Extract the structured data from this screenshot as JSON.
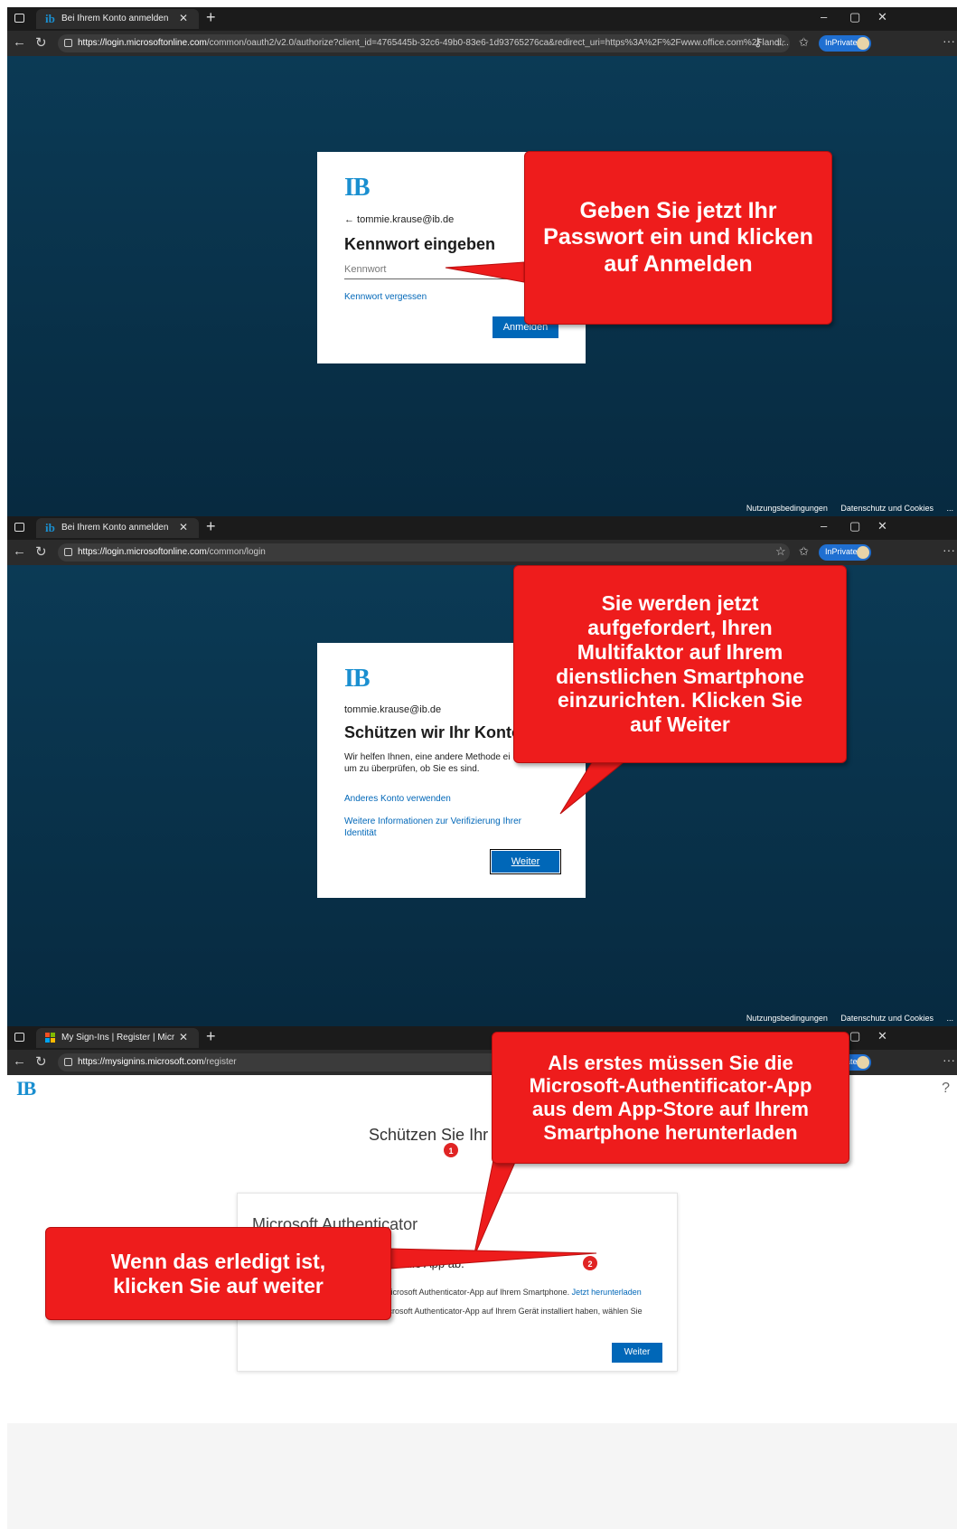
{
  "colors": {
    "callout": "#ee1c1c",
    "ms_blue": "#0067b8",
    "ib_blue": "#1a8fd0",
    "bg_dark": "#0b3a55"
  },
  "panel1": {
    "tab_title": "Bei Ihrem Konto anmelden",
    "url_domain": "https://login.microsoftonline.com",
    "url_path": "/common/oauth2/v2.0/authorize?client_id=4765445b-32c6-49b0-83e6-1d93765276ca&redirect_uri=https%3A%2F%2Fwww.office.com%2Flandi...",
    "inprivate": "InPrivate",
    "logo": "IB",
    "email": "← tommie.krause@ib.de",
    "heading": "Kennwort eingeben",
    "password_placeholder": "Kennwort",
    "forgot_link": "Kennwort vergessen",
    "signin_button": "Anmelden",
    "callout": "Geben Sie jetzt Ihr\nPasswort ein und klicken\nauf Anmelden",
    "footer_terms": "Nutzungsbedingungen",
    "footer_privacy": "Datenschutz und Cookies",
    "footer_more": "..."
  },
  "panel2": {
    "tab_title": "Bei Ihrem Konto anmelden",
    "url_domain": "https://login.microsoftonline.com",
    "url_path": "/common/login",
    "inprivate": "InPrivate",
    "logo": "IB",
    "email": "tommie.krause@ib.de",
    "heading": "Schützen wir Ihr Konto",
    "description": "Wir helfen Ihnen, eine andere Methode ei\num zu überprüfen, ob Sie es sind.",
    "link_other_account": "Anderes Konto verwenden",
    "link_more_info": "Weitere Informationen zur Verifizierung Ihrer\nIdentität",
    "next_button": "Weiter",
    "callout": "Sie werden jetzt\naufgefordert, Ihren\nMultifaktor auf Ihrem\ndienstlichen Smartphone\neinzurichten. Klicken Sie\nauf Weiter",
    "footer_terms": "Nutzungsbedingungen",
    "footer_privacy": "Datenschutz und Cookies",
    "footer_more": "..."
  },
  "panel3": {
    "tab_title": "My Sign-Ins | Register | Microsoft",
    "url_domain": "https://mysignins.microsoft.com",
    "url_path": "/register",
    "inprivate": "InPrivate",
    "logo": "IB",
    "help": "?",
    "page_title": "Schützen Sie Ihr",
    "card_title": "Microsoft Authenticator",
    "card_subtitle": "Rufen Sie zuerst die App ab.",
    "card_line1": "Installieren Sie die Microsoft Authenticator-App auf Ihrem Smartphone.",
    "card_download_link": "Jetzt herunterladen",
    "card_line2": "Nachdem Sie die Microsoft Authenticator-App auf Ihrem Gerät installiert haben, wählen Sie",
    "next_button": "Weiter",
    "badge1": "1",
    "badge2": "2",
    "callout_top": "Als erstes müssen Sie die\nMicrosoft-Authentificator-App\naus dem App-Store auf Ihrem\nSmartphone herunterladen",
    "callout_bottom": "Wenn das erledigt ist,\nklicken Sie auf weiter"
  }
}
